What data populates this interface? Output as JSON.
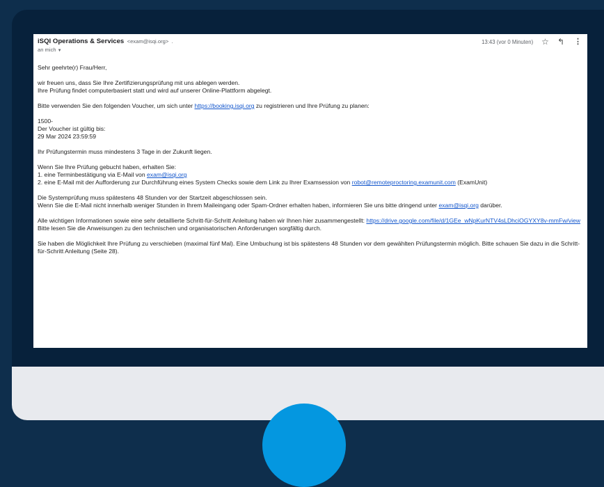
{
  "email": {
    "sender_name": "iSQI Operations & Services",
    "sender_email": "<exam@isqi.org>",
    "sender_email_suffix": ".",
    "to_label": "an mich",
    "time": "13:43 (vor 0 Minuten)",
    "icons": {
      "star": "star-icon",
      "reply": "reply-icon",
      "more": "more-vert-icon"
    },
    "salutation": "Sehr geehrte(r) Frau/Herr,",
    "intro_line1": "wir freuen uns, dass Sie Ihre Zertifizierungsprüfung mit uns ablegen werden.",
    "intro_line2": "Ihre Prüfung findet computerbasiert statt und wird auf unserer Online-Plattform abgelegt.",
    "voucher_instruction_pre": "Bitte verwenden Sie den folgenden Voucher, um sich unter ",
    "voucher_link": "https://booking.isqi.org",
    "voucher_instruction_post": " zu registrieren und Ihre Prüfung zu planen:",
    "voucher_code": "1500-",
    "voucher_valid_label": "Der Voucher ist gültig bis:",
    "voucher_valid_date": "29 Mar 2024 23:59:59",
    "appointment_note": "Ihr Prüfungstermin muss mindestens 3 Tage in der Zukunft liegen.",
    "after_booking": "Wenn Sie Ihre Prüfung gebucht haben, erhalten Sie:",
    "item1_pre": "1. eine Terminbestätigung via E-Mail von ",
    "item1_link": "exam@isqi.org",
    "item2_pre": "2. eine E-Mail mit der Aufforderung zur Durchführung eines System Checks sowie dem Link zu Ihrer Examsession von ",
    "item2_link": "robot@remoteproctoring.examunit.com",
    "item2_post": " (ExamUnit)",
    "syscheck_line1": "Die Systemprüfung muss spätestens 48 Stunden vor der Startzeit abgeschlossen sein.",
    "syscheck_line2_pre": "Wenn Sie die E-Mail nicht innerhalb weniger Stunden in Ihrem Maileingang oder Spam-Ordner erhalten haben, informieren Sie uns bitte dringend unter ",
    "syscheck_link": "exam@isqi.org",
    "syscheck_line2_post": " darüber.",
    "guide_pre": "Alle wichtigen Informationen sowie eine sehr detaillierte Schritt-für-Schritt Anleitung haben wir Ihnen hier zusammengestellt: ",
    "guide_link": "https://drive.google.com/file/d/1GEe_wNpKurNTV4sLDhciOGYXY8v-mmFw/view",
    "guide_read": "Bitte lesen Sie die Anweisungen zu den technischen und organisatorischen Anforderungen sorgfältig durch.",
    "reschedule": "Sie haben die Möglichkeit Ihre Prüfung zu verschieben (maximal fünf Mal). Eine Umbuchung ist bis spätestens 48 Stunden vor dem gewählten Prüfungstermin möglich. Bitte schauen Sie dazu in die Schritt-für-Schritt Anleitung (Seite 28)."
  }
}
